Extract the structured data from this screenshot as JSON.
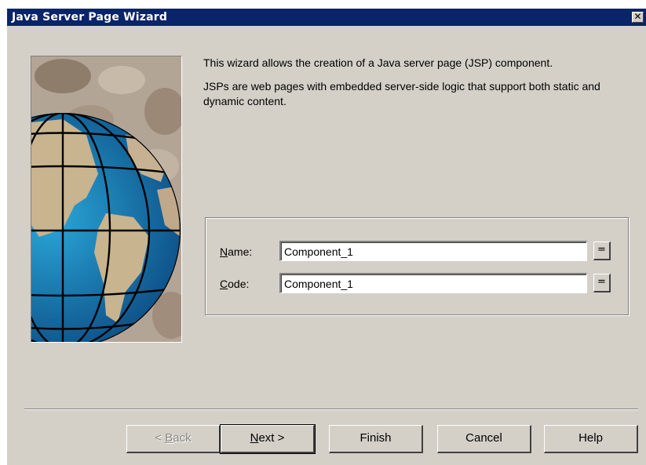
{
  "window": {
    "title": "Java Server Page Wizard",
    "close_glyph": "✕"
  },
  "intro": {
    "line1": "This wizard allows the creation of a Java server page (JSP) component.",
    "line2": "JSPs are web pages with embedded server-side logic that support both static and dynamic content."
  },
  "form": {
    "name": {
      "label_key": "N",
      "label_rest": "ame:",
      "value": "Component_1",
      "sync_label": "="
    },
    "code": {
      "label_key": "C",
      "label_rest": "ode:",
      "value": "Component_1",
      "sync_label": "="
    }
  },
  "buttons": {
    "back": {
      "prefix": "< ",
      "key": "B",
      "rest": "ack"
    },
    "next": {
      "key": "N",
      "rest": "ext >"
    },
    "finish": "Finish",
    "cancel": "Cancel",
    "help": "Help"
  },
  "colors": {
    "titlebar": "#0a246a",
    "dialog": "#d4d0c8"
  },
  "icons": {
    "art": "globe-coffee-beans-image",
    "close": "close-icon"
  }
}
